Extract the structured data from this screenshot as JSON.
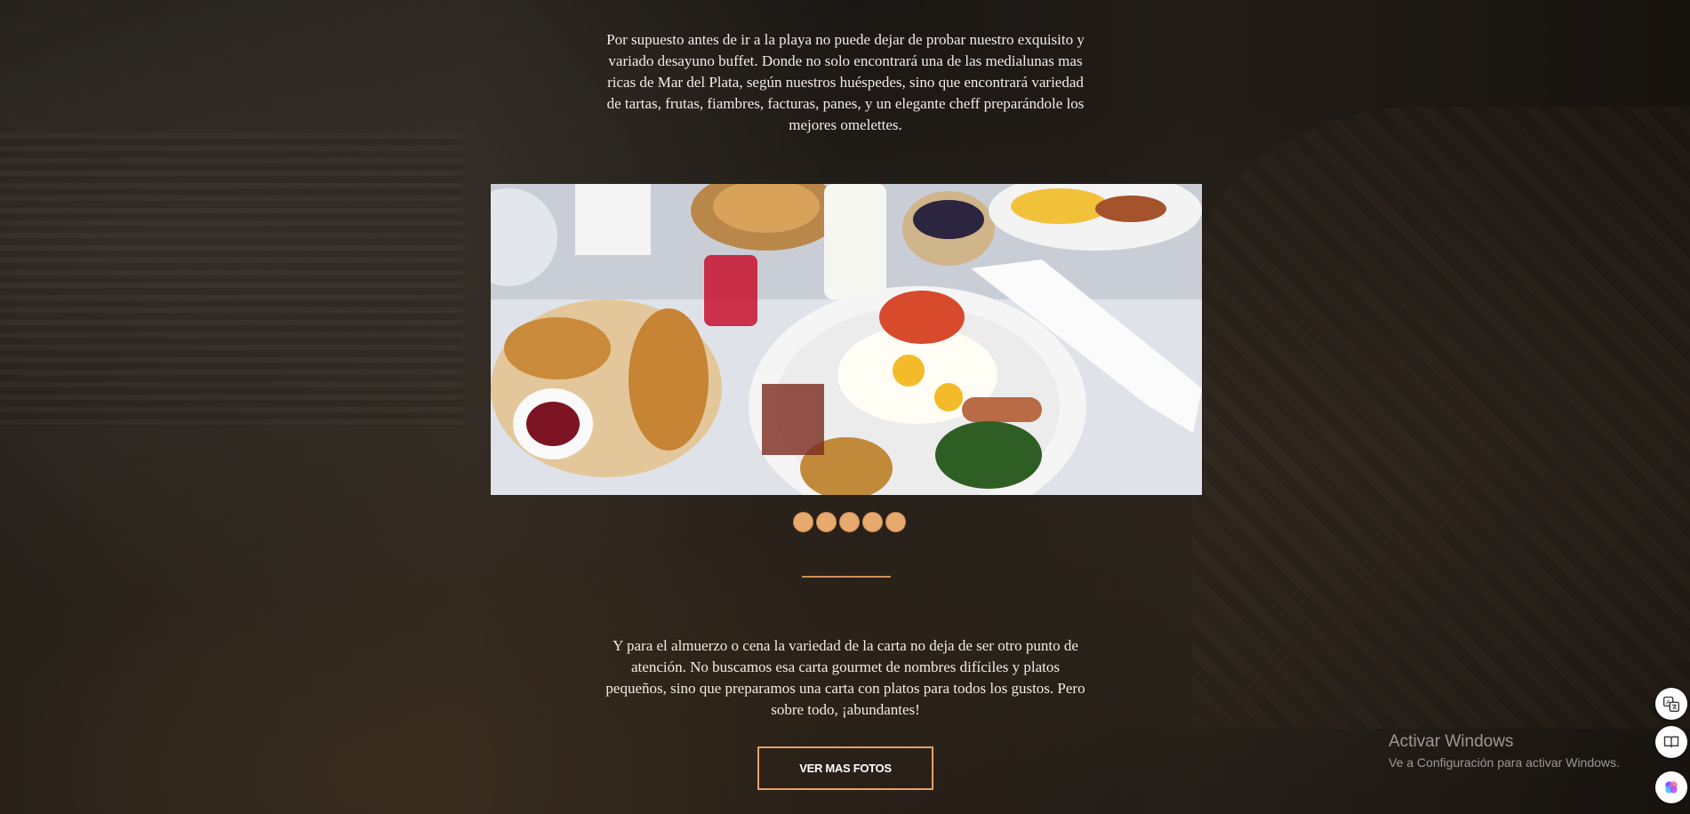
{
  "content": {
    "intro_paragraph": "Por supuesto antes de ir a la playa no puede dejar de probar nuestro exquisito y variado desayuno buffet. Donde no solo encontrará una de las medialunas mas ricas de Mar del Plata, según nuestros huéspedes, sino que encontrará variedad de tartas, frutas, fiambres, facturas, panes, y un elegante cheff preparándole los mejores omelettes.",
    "lunch_paragraph": "Y para el almuerzo o cena la variedad de la carta no deja de ser otro punto de atención. No buscamos esa carta gourmet de nombres difíciles y platos pequeños, sino que preparamos una carta con platos para todos los gustos. Pero sobre todo, ¡abundantes!",
    "button_label": "VER MAS FOTOS"
  },
  "slider": {
    "slide_count": 5,
    "current": 1
  },
  "watermark": {
    "line1": "Activar Windows",
    "line2": "Ve a Configuración para activar Windows."
  },
  "colors": {
    "accent": "#e8a96f",
    "text": "#f3ece3"
  },
  "side_icons": [
    "translate-icon",
    "reader-icon",
    "ai-assistant-icon"
  ]
}
